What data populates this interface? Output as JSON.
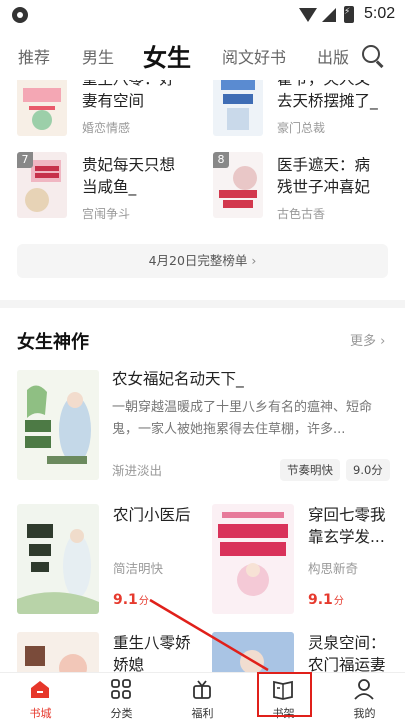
{
  "status_bar": {
    "time": "5:02"
  },
  "tabs": [
    {
      "label": "推荐",
      "active": false
    },
    {
      "label": "男生",
      "active": false
    },
    {
      "label": "女生",
      "active": true
    },
    {
      "label": "阅文好书",
      "active": false
    },
    {
      "label": "出版",
      "active": false
    }
  ],
  "ranking": {
    "items": [
      {
        "rank": "",
        "title_line1": "重生八零：好",
        "title_line2": "妻有空间",
        "category": "婚恋情感"
      },
      {
        "rank": "",
        "title_line1": "霍爷，夫人又",
        "title_line2": "去天桥摆摊了_",
        "category": "豪门总裁"
      },
      {
        "rank": "7",
        "title_line1": "贵妃每天只想",
        "title_line2": "当咸鱼_",
        "category": "宫闱争斗"
      },
      {
        "rank": "8",
        "title_line1": "医手遮天：病",
        "title_line2": "残世子冲喜妃",
        "category": "古色古香"
      }
    ],
    "full_list_label": "4月20日完整榜单"
  },
  "section": {
    "title": "女生神作",
    "more_label": "更多"
  },
  "featured": {
    "title": "农女福妃名动天下_",
    "description": "一朝穿越温暖成了十里八乡有名的瘟神、短命鬼，一家人被她拖累得去住草棚，许多...",
    "author": "渐进淡出",
    "tag": "节奏明快",
    "score": "9.0分"
  },
  "grid_books": [
    {
      "title_line1": "农门小医后",
      "title_line2": "",
      "author": "简洁明快",
      "score": "9.1",
      "score_unit": "分"
    },
    {
      "title_line1": "穿回七零我",
      "title_line2": "靠玄学发...",
      "author": "构思新奇",
      "score": "9.1",
      "score_unit": "分"
    },
    {
      "title_line1": "重生八零娇",
      "title_line2": "娇媳",
      "author": "",
      "score": "",
      "score_unit": ""
    },
    {
      "title_line1": "灵泉空间：",
      "title_line2": "农门福运妻",
      "author": "",
      "score": "",
      "score_unit": ""
    }
  ],
  "bottom_nav": [
    {
      "label": "书城",
      "icon": "home-icon",
      "active": true
    },
    {
      "label": "分类",
      "icon": "grid-icon",
      "active": false
    },
    {
      "label": "福利",
      "icon": "gift-icon",
      "active": false
    },
    {
      "label": "书架",
      "icon": "bookshelf-icon",
      "active": false
    },
    {
      "label": "我的",
      "icon": "profile-icon",
      "active": false
    }
  ],
  "colors": {
    "accent": "#e6372b",
    "annotation": "#e0201a"
  }
}
